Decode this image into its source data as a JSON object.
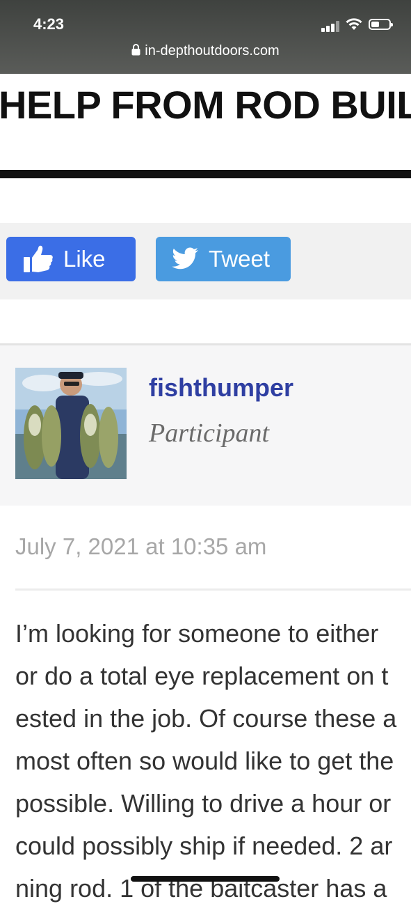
{
  "status_bar": {
    "time": "4:23"
  },
  "browser": {
    "url": "in-depthoutdoors.com"
  },
  "page": {
    "title": "HELP FROM ROD BUIL"
  },
  "share": {
    "like_label": "Like",
    "tweet_label": "Tweet"
  },
  "author": {
    "name": "fishthumper",
    "role": "Participant"
  },
  "post": {
    "date": "July 7, 2021 at 10:35 am",
    "lines": [
      "I’m looking for someone to either",
      "or do a total eye replacement on t",
      "ested in the job. Of course these a",
      "most often so would like to get the",
      "possible. Willing to drive a hour or",
      "could possibly ship if needed. 2 ar",
      "ning rod. 1 of the baitcaster has a"
    ]
  },
  "colors": {
    "like": "#3b6ee6",
    "tweet": "#4a9be0",
    "author_name": "#2f3fa2"
  }
}
